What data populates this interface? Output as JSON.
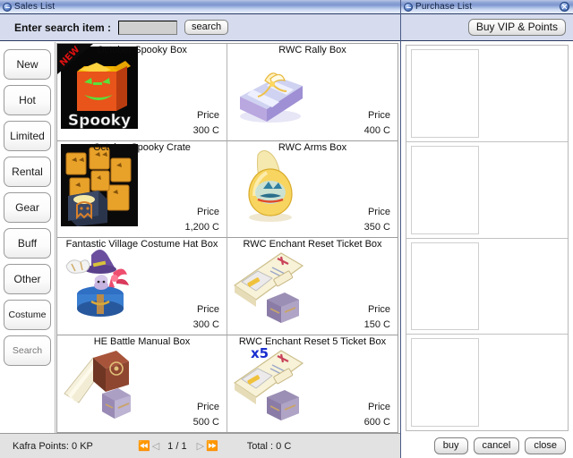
{
  "left_window": {
    "title": "Sales List",
    "title_icon": "window-dot-icon",
    "toolbar": {
      "search_label": "Enter search item :",
      "search_value": "",
      "search_placeholder": "",
      "search_button": "search"
    },
    "sidebar": {
      "items": [
        {
          "label": "New"
        },
        {
          "label": "Hot"
        },
        {
          "label": "Limited"
        },
        {
          "label": "Rental"
        },
        {
          "label": "Gear"
        },
        {
          "label": "Buff"
        },
        {
          "label": "Other"
        },
        {
          "label": "Costume"
        },
        {
          "label": "Search"
        }
      ]
    },
    "items": [
      {
        "name": "October Spooky Box",
        "price_label": "Price",
        "price": "300 C",
        "badge": "NEW",
        "multiplier": "",
        "icon": "spooky-box-icon"
      },
      {
        "name": "RWC Rally Box",
        "price_label": "Price",
        "price": "400 C",
        "badge": "",
        "multiplier": "",
        "icon": "gift-box-icon"
      },
      {
        "name": "October Spooky Crate",
        "price_label": "Price",
        "price": "1,200 C",
        "badge": "",
        "multiplier": "",
        "icon": "spooky-crate-icon"
      },
      {
        "name": "RWC Arms Box",
        "price_label": "Price",
        "price": "350 C",
        "badge": "",
        "multiplier": "",
        "icon": "golden-egg-icon"
      },
      {
        "name": "Fantastic Village Costume Hat Box",
        "price_label": "Price",
        "price": "300 C",
        "badge": "",
        "multiplier": "",
        "icon": "costume-hat-icon"
      },
      {
        "name": "RWC Enchant Reset Ticket Box",
        "price_label": "Price",
        "price": "150 C",
        "badge": "",
        "multiplier": "",
        "icon": "ticket-box-icon"
      },
      {
        "name": "HE Battle Manual Box",
        "price_label": "Price",
        "price": "500 C",
        "badge": "",
        "multiplier": "",
        "icon": "battle-manual-icon"
      },
      {
        "name": "RWC Enchant Reset 5 Ticket Box",
        "price_label": "Price",
        "price": "600 C",
        "badge": "",
        "multiplier": "x5",
        "icon": "ticket-box-icon"
      }
    ],
    "status": {
      "kafra_points": "Kafra Points: 0 KP",
      "page": "1 / 1",
      "first_arrow": "⏪",
      "prev_arrow": "◁",
      "next_arrow": "▷",
      "last_arrow": "⏩",
      "total": "Total : 0 C"
    }
  },
  "right_window": {
    "title": "Purchase List",
    "title_icon": "window-dot-icon",
    "close_icon": "close-circle-icon",
    "toolbar": {
      "vip_button": "Buy VIP & Points"
    },
    "slots": [
      {},
      {},
      {},
      {}
    ],
    "footer": {
      "buy": "buy",
      "cancel": "cancel",
      "close": "close"
    }
  },
  "colors": {
    "title_blue": "#7f97cf",
    "toolbar_lavender": "#d6dcee",
    "badge_red": "#cc1111",
    "multiplier_blue": "#1a2ed0"
  }
}
